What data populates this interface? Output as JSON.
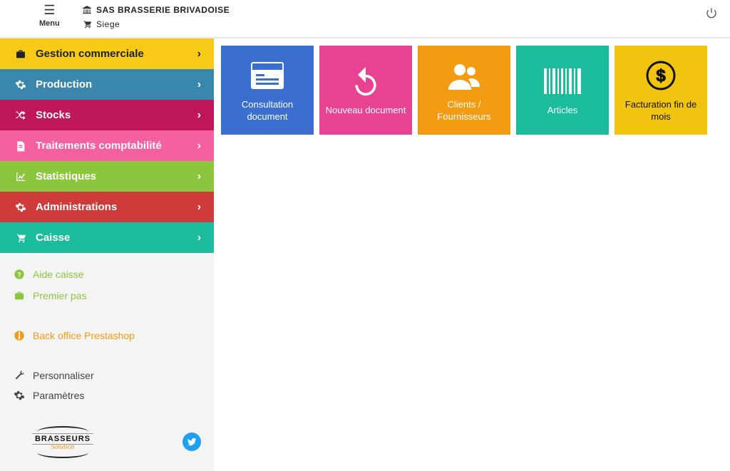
{
  "header": {
    "menu_label": "Menu",
    "company": "SAS BRASSERIE BRIVADOISE",
    "location": "Siege"
  },
  "nav": {
    "items": [
      {
        "icon": "briefcase-icon",
        "label": "Gestion commerciale",
        "color": "yellow"
      },
      {
        "icon": "gear-icon",
        "label": "Production",
        "color": "blue"
      },
      {
        "icon": "shuffle-icon",
        "label": "Stocks",
        "color": "magenta"
      },
      {
        "icon": "file-icon",
        "label": "Traitements comptabilité",
        "color": "pink"
      },
      {
        "icon": "chart-icon",
        "label": "Statistiques",
        "color": "green"
      },
      {
        "icon": "cog-icon",
        "label": "Administrations",
        "color": "red"
      },
      {
        "icon": "cart-icon",
        "label": "Caisse",
        "color": "teal"
      }
    ]
  },
  "links": {
    "help": {
      "label": "Aide caisse"
    },
    "first_step": {
      "label": "Premier pas"
    },
    "back_office": {
      "label": "Back office Prestashop"
    },
    "customize": {
      "label": "Personnaliser"
    },
    "settings": {
      "label": "Paramètres"
    }
  },
  "logo": {
    "brand": "BRASSEURS",
    "sub": "Solution"
  },
  "tiles": [
    {
      "icon": "doc-consult-icon",
      "label": "Consultation document",
      "color": "blue"
    },
    {
      "icon": "undo-icon",
      "label": "Nouveau document",
      "color": "pink"
    },
    {
      "icon": "users-icon",
      "label": "Clients / Fournisseurs",
      "color": "orange"
    },
    {
      "icon": "barcode-icon",
      "label": "Articles",
      "color": "teal"
    },
    {
      "icon": "dollar-icon",
      "label": "Facturation fin de mois",
      "color": "yellow"
    }
  ]
}
